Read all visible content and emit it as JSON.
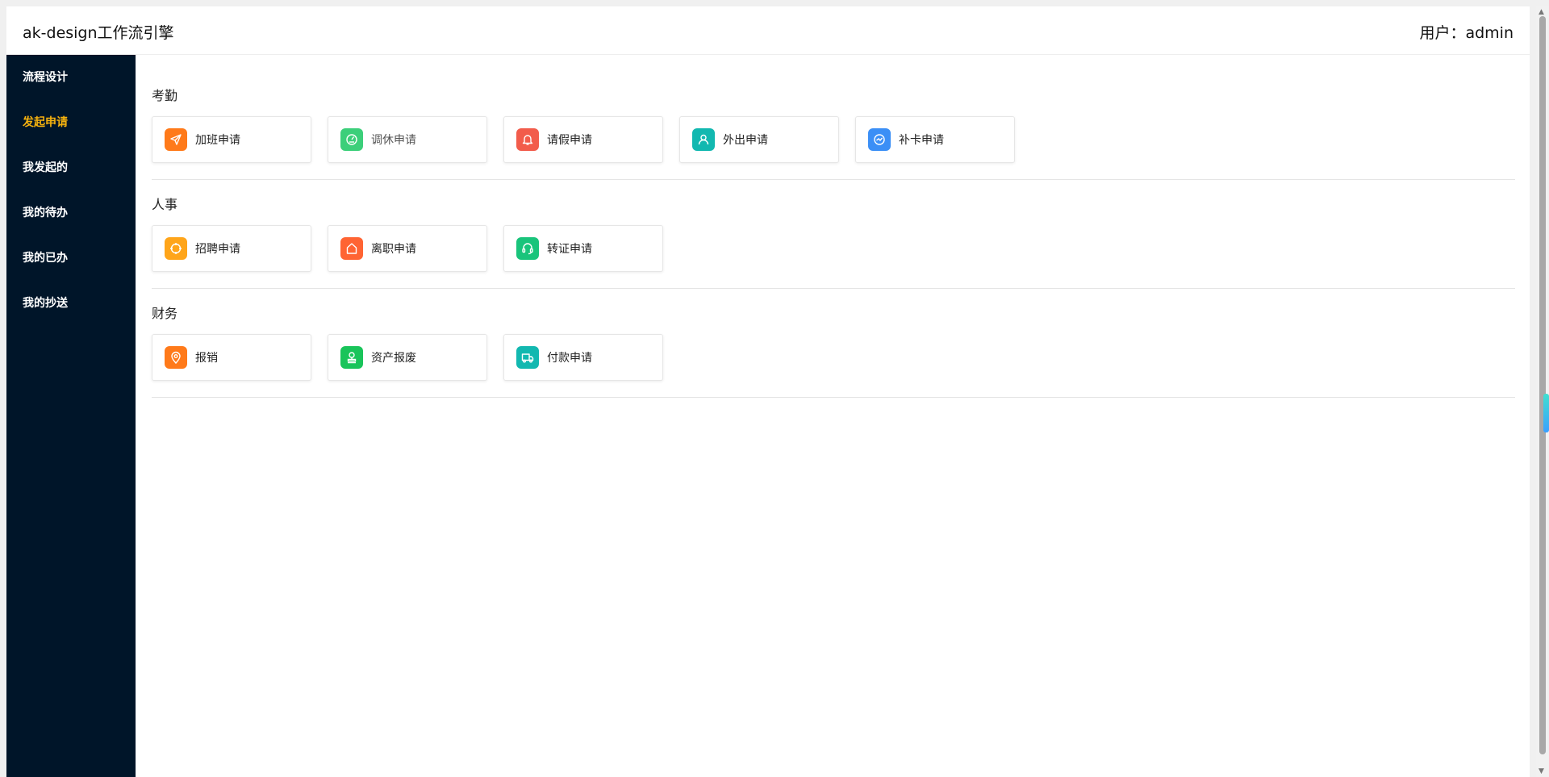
{
  "header": {
    "title": "ak-design工作流引擎",
    "user": "用户：admin"
  },
  "sidebar": {
    "items": [
      {
        "label": "流程设计",
        "active": false
      },
      {
        "label": "发起申请",
        "active": true
      },
      {
        "label": "我发起的",
        "active": false
      },
      {
        "label": "我的待办",
        "active": false
      },
      {
        "label": "我的已办",
        "active": false
      },
      {
        "label": "我的抄送",
        "active": false
      }
    ]
  },
  "sections": [
    {
      "title": "考勤",
      "cards": [
        {
          "label": "加班申请",
          "icon": "paper-plane-icon",
          "color": "#ff7a1a"
        },
        {
          "label": "调休申请",
          "icon": "gauge-icon",
          "color": "#3ccf7a"
        },
        {
          "label": "请假申请",
          "icon": "bell-icon",
          "color": "#f25c4b"
        },
        {
          "label": "外出申请",
          "icon": "user-icon",
          "color": "#12b8b0"
        },
        {
          "label": "补卡申请",
          "icon": "chart-circle-icon",
          "color": "#3b8ff6"
        }
      ]
    },
    {
      "title": "人事",
      "cards": [
        {
          "label": "招聘申请",
          "icon": "target-icon",
          "color": "#ffa51a"
        },
        {
          "label": "离职申请",
          "icon": "home-icon",
          "color": "#ff6433"
        },
        {
          "label": "转证申请",
          "icon": "headset-icon",
          "color": "#19c47b"
        }
      ]
    },
    {
      "title": "财务",
      "cards": [
        {
          "label": "报销",
          "icon": "location-pin-icon",
          "color": "#ff7a1a"
        },
        {
          "label": "资产报废",
          "icon": "stamp-icon",
          "color": "#19c45a"
        },
        {
          "label": "付款申请",
          "icon": "truck-icon",
          "color": "#12b8b0"
        }
      ]
    }
  ]
}
